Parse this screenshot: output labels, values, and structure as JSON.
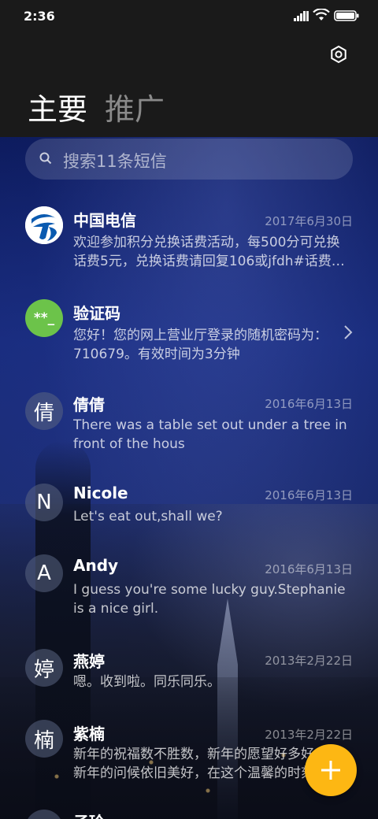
{
  "status_bar": {
    "time": "2:36"
  },
  "tabs": {
    "main": "主要",
    "promo": "推广"
  },
  "search": {
    "placeholder": "搜索11条短信"
  },
  "conversations": [
    {
      "avatar_text": "",
      "avatar_icon": "china-telecom-logo-icon",
      "name": "中国电信",
      "date": "2017年6月30日",
      "line1": "欢迎参加积分兑换话费活动，每500分可兑换",
      "line2": "话费5元，兑换话费请回复106或jfdh#话费…"
    },
    {
      "avatar_text": "**_",
      "name": "验证码",
      "date": "",
      "line1": "您好！您的网上营业厅登录的随机密码为：",
      "line2": "710679。有效时间为3分钟"
    },
    {
      "avatar_text": "倩",
      "name": "倩倩",
      "date": "2016年6月13日",
      "line1": "There was a table set out under a tree in",
      "line2": "front of the hous"
    },
    {
      "avatar_text": "N",
      "name": "Nicole",
      "date": "2016年6月13日",
      "line1": "Let's eat out,shall we?",
      "line2": ""
    },
    {
      "avatar_text": "A",
      "name": "Andy",
      "date": "2016年6月13日",
      "line1": "I guess you're some lucky guy.Stephanie",
      "line2": "is a nice girl."
    },
    {
      "avatar_text": "婷",
      "name": "燕婷",
      "date": "2013年2月22日",
      "line1": "嗯。收到啦。同乐同乐。",
      "line2": ""
    },
    {
      "avatar_text": "楠",
      "name": "紫楠",
      "date": "2013年2月22日",
      "line1": "新年的祝福数不胜数，新年的愿望好多好多，",
      "line2": "新年的问候依旧美好，在这个温馨的时刻"
    },
    {
      "avatar_text": "",
      "name": "子玲",
      "date": "",
      "line1": "",
      "line2": ""
    }
  ],
  "colors": {
    "fab": "#fdb713",
    "verify_avatar": "#6cc34a",
    "telecom_blue": "#0a5ab0"
  }
}
